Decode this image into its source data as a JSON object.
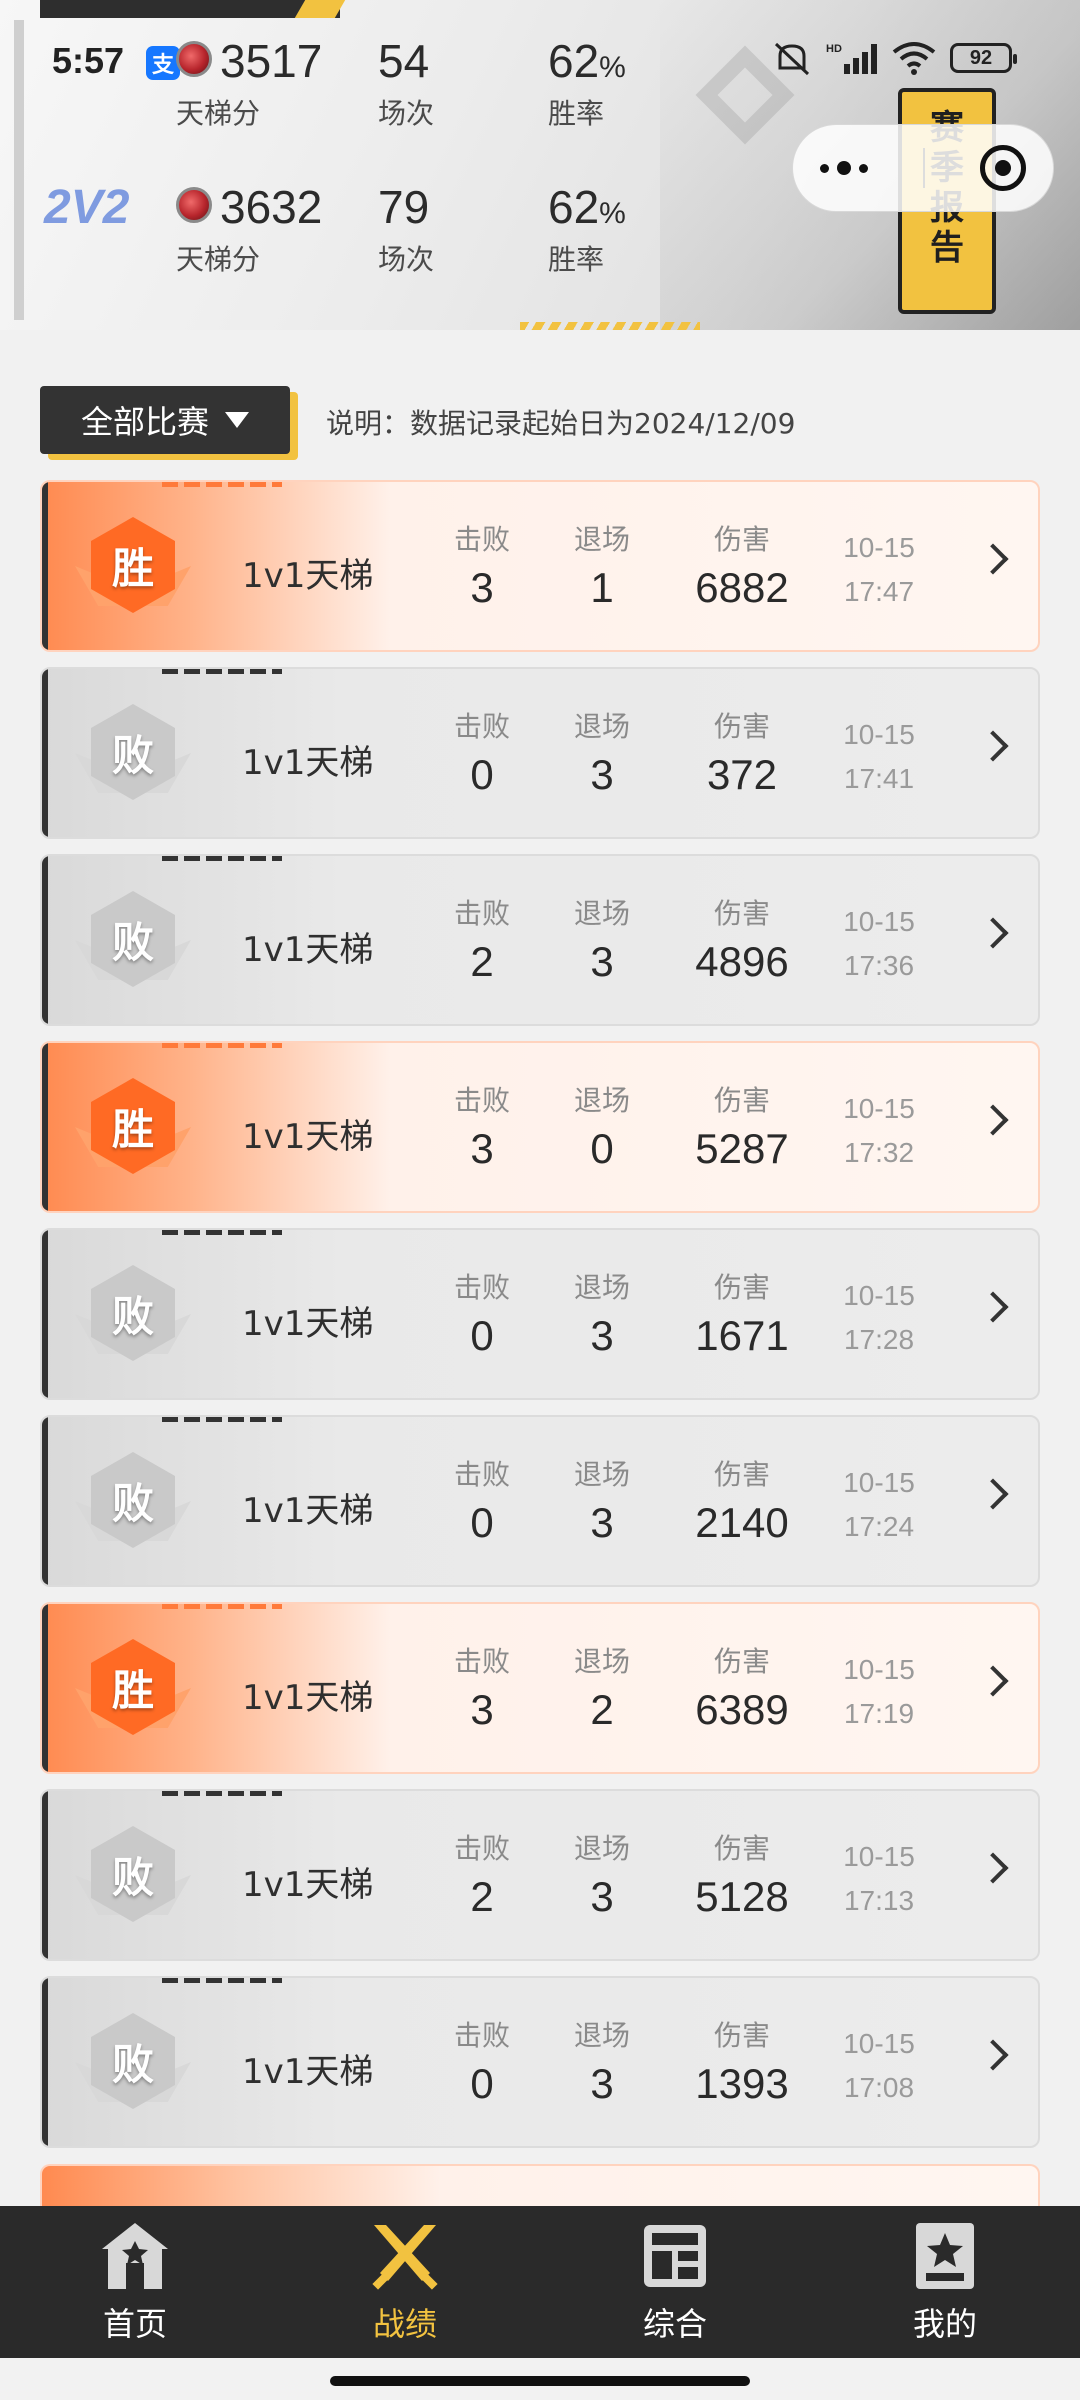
{
  "status_bar": {
    "time": "5:57",
    "alipay_badge": "支",
    "battery": "92"
  },
  "header": {
    "modes": [
      {
        "mode": "",
        "ladder_score": "3517",
        "matches": "54",
        "win_rate": "62",
        "win_rate_unit": "%"
      },
      {
        "mode": "2V2",
        "ladder_score": "3632",
        "matches": "79",
        "win_rate": "62",
        "win_rate_unit": "%"
      }
    ],
    "labels": {
      "ladder_score": "天梯分",
      "matches": "场次",
      "win_rate": "胜率"
    },
    "season_report": [
      "赛",
      "季",
      "报",
      "告"
    ]
  },
  "filter": {
    "label": "全部比赛",
    "note": "说明：数据记录起始日为2024/12/09"
  },
  "columns": {
    "kills": "击败",
    "exits": "退场",
    "damage": "伤害"
  },
  "matches": [
    {
      "result": "胜",
      "outcome": "win",
      "mode": "1v1天梯",
      "kills": "3",
      "exits": "1",
      "damage": "6882",
      "date": "10-15",
      "time": "17:47"
    },
    {
      "result": "败",
      "outcome": "loss",
      "mode": "1v1天梯",
      "kills": "0",
      "exits": "3",
      "damage": "372",
      "date": "10-15",
      "time": "17:41"
    },
    {
      "result": "败",
      "outcome": "loss",
      "mode": "1v1天梯",
      "kills": "2",
      "exits": "3",
      "damage": "4896",
      "date": "10-15",
      "time": "17:36"
    },
    {
      "result": "胜",
      "outcome": "win",
      "mode": "1v1天梯",
      "kills": "3",
      "exits": "0",
      "damage": "5287",
      "date": "10-15",
      "time": "17:32"
    },
    {
      "result": "败",
      "outcome": "loss",
      "mode": "1v1天梯",
      "kills": "0",
      "exits": "3",
      "damage": "1671",
      "date": "10-15",
      "time": "17:28"
    },
    {
      "result": "败",
      "outcome": "loss",
      "mode": "1v1天梯",
      "kills": "0",
      "exits": "3",
      "damage": "2140",
      "date": "10-15",
      "time": "17:24"
    },
    {
      "result": "胜",
      "outcome": "win",
      "mode": "1v1天梯",
      "kills": "3",
      "exits": "2",
      "damage": "6389",
      "date": "10-15",
      "time": "17:19"
    },
    {
      "result": "败",
      "outcome": "loss",
      "mode": "1v1天梯",
      "kills": "2",
      "exits": "3",
      "damage": "5128",
      "date": "10-15",
      "time": "17:13"
    },
    {
      "result": "败",
      "outcome": "loss",
      "mode": "1v1天梯",
      "kills": "0",
      "exits": "3",
      "damage": "1393",
      "date": "10-15",
      "time": "17:08"
    }
  ],
  "nav": [
    {
      "label": "首页",
      "icon": "home-icon",
      "active": false
    },
    {
      "label": "战绩",
      "icon": "crossed-swords-icon",
      "active": true
    },
    {
      "label": "综合",
      "icon": "overview-panel-icon",
      "active": false
    },
    {
      "label": "我的",
      "icon": "profile-card-icon",
      "active": false
    }
  ],
  "colors": {
    "accent": "#f2c240",
    "win": "#ff6a24",
    "loss": "#c9c9c9",
    "nav_bg": "#2a2a2a"
  }
}
